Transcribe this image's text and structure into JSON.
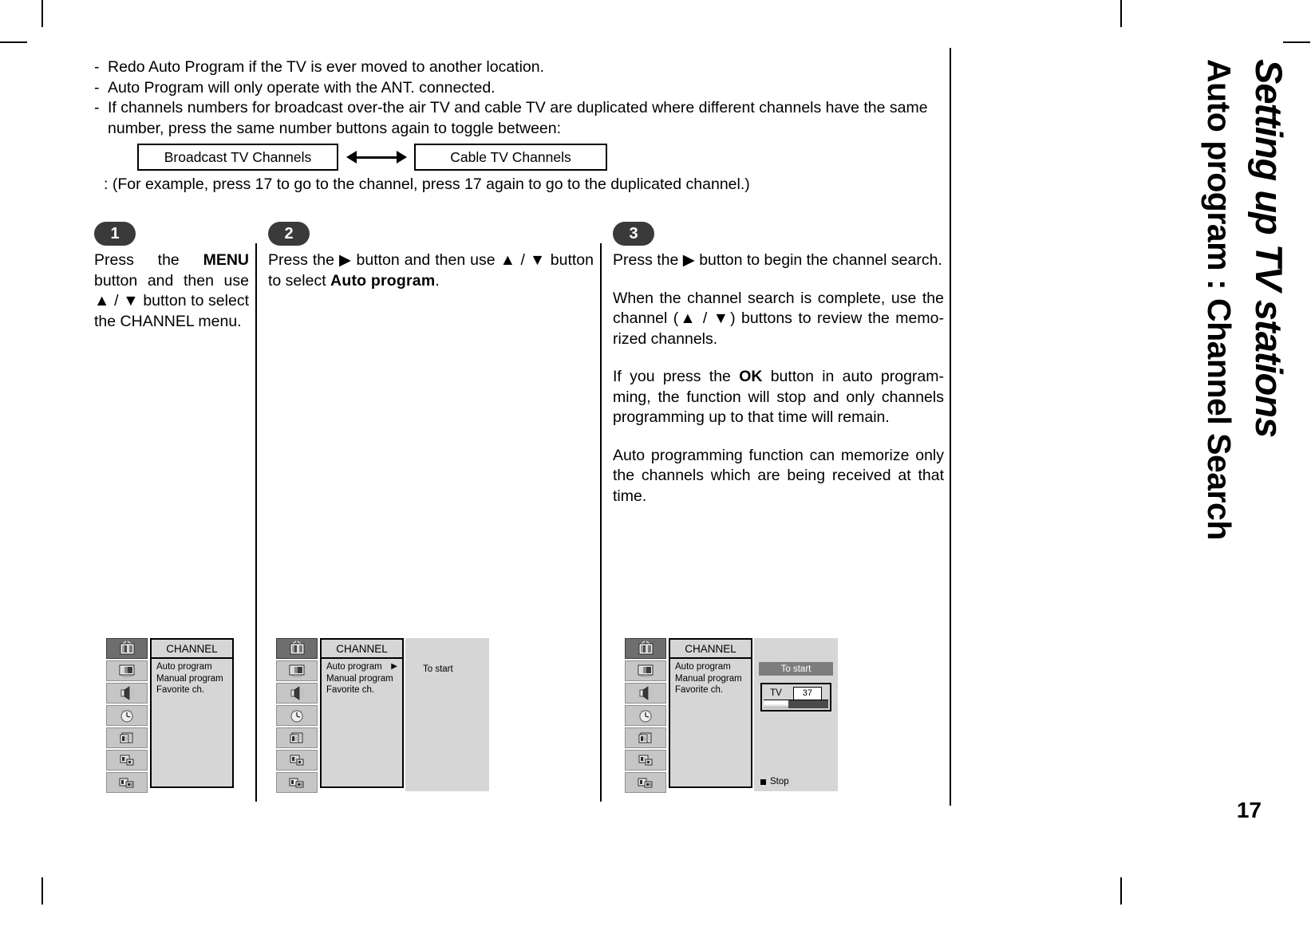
{
  "notes": [
    {
      "dash": "-",
      "text": "Redo Auto Program if the TV is ever moved to another location."
    },
    {
      "dash": "-",
      "text": "Auto Program will only operate with the ANT. connected."
    },
    {
      "dash": "-",
      "text": "If channels numbers for broadcast over-the air TV and cable TV are duplicated where different channels have the same number, press the same number buttons again to toggle between:"
    }
  ],
  "toggle": {
    "broadcast_label": "Broadcast TV Channels",
    "cable_label": "Cable TV Channels",
    "arrow_icon": "double-arrow-icon"
  },
  "example_line": ": (For example, press 17 to go to the channel, press 17 again to go to the duplicated channel.)",
  "steps": [
    {
      "number": "1",
      "paragraphs": [
        {
          "parts": [
            {
              "t": "Press   the   ",
              "style": "normal"
            },
            {
              "t": "MENU",
              "style": "bold"
            },
            {
              "t": " button and then use ",
              "style": "normal"
            },
            {
              "t": "▲",
              "style": "normal"
            },
            {
              "t": " / ",
              "style": "normal"
            },
            {
              "t": "▼",
              "style": "normal"
            },
            {
              "t": " button to select the CHANNEL menu.",
              "style": "normal"
            }
          ]
        }
      ]
    },
    {
      "number": "2",
      "paragraphs": [
        {
          "parts": [
            {
              "t": "Press the ",
              "style": "normal"
            },
            {
              "t": "▶",
              "style": "normal"
            },
            {
              "t": " button and then use ",
              "style": "normal"
            },
            {
              "t": "▲",
              "style": "normal"
            },
            {
              "t": " / ",
              "style": "normal"
            },
            {
              "t": "▼",
              "style": "normal"
            },
            {
              "t": " button to select ",
              "style": "normal"
            },
            {
              "t": "Auto program",
              "style": "bold-rounded"
            },
            {
              "t": ".",
              "style": "normal"
            }
          ]
        }
      ]
    },
    {
      "number": "3",
      "paragraphs": [
        {
          "parts": [
            {
              "t": "Press   the   ",
              "style": "normal"
            },
            {
              "t": "▶",
              "style": "normal"
            },
            {
              "t": "   button   to   begin   the   channel search.",
              "style": "normal"
            }
          ]
        },
        {
          "parts": [
            {
              "t": "When the channel search is complete, use the channel (",
              "style": "normal"
            },
            {
              "t": "▲",
              "style": "normal"
            },
            {
              "t": " / ",
              "style": "normal"
            },
            {
              "t": "▼",
              "style": "normal"
            },
            {
              "t": ") buttons to review the memo-rized channels.",
              "style": "normal"
            }
          ]
        },
        {
          "parts": [
            {
              "t": "If  you  press  the  ",
              "style": "normal"
            },
            {
              "t": "OK",
              "style": "bold"
            },
            {
              "t": "  button  in  auto  program-ming, the function will stop and only channels programming up to that time will remain.",
              "style": "normal"
            }
          ]
        },
        {
          "parts": [
            {
              "t": "Auto programming function can memorize only the channels which are being received at that time.",
              "style": "normal"
            }
          ]
        }
      ]
    }
  ],
  "osd": {
    "icons": [
      "tv-antenna-icon",
      "picture-icon",
      "sound-icon",
      "clock-icon",
      "special-icon",
      "screen-icon",
      "pip-icon"
    ],
    "menu_title": "CHANNEL",
    "menu_items": [
      "Auto program",
      "Manual program",
      "Favorite ch."
    ],
    "arrow_glyph": "▶",
    "to_start": "To start",
    "tv_label": "TV",
    "tv_channel": "37",
    "stop_label": "Stop",
    "progress_percent": 38
  },
  "panels": [
    {
      "id": "panel-1",
      "selected_item_index": -1,
      "show_arrow": false,
      "show_right_panel": false
    },
    {
      "id": "panel-2",
      "selected_item_index": 0,
      "show_arrow": true,
      "show_right_panel": true
    },
    {
      "id": "panel-3",
      "selected_item_index": 0,
      "show_arrow": false,
      "show_right_panel": true
    }
  ],
  "header": {
    "title_line1": "Setting up TV stations",
    "title_line2": "Auto program : Channel Search"
  },
  "page_number": "17",
  "colors": {
    "osd_background": "#d6d6d6",
    "osd_icon_cell": "#c6c6c6",
    "osd_icon_selected": "#6e6e6e",
    "band": "#7d7d7d",
    "badge": "#3a3a3a",
    "progress_track": "#4a4a4a"
  }
}
